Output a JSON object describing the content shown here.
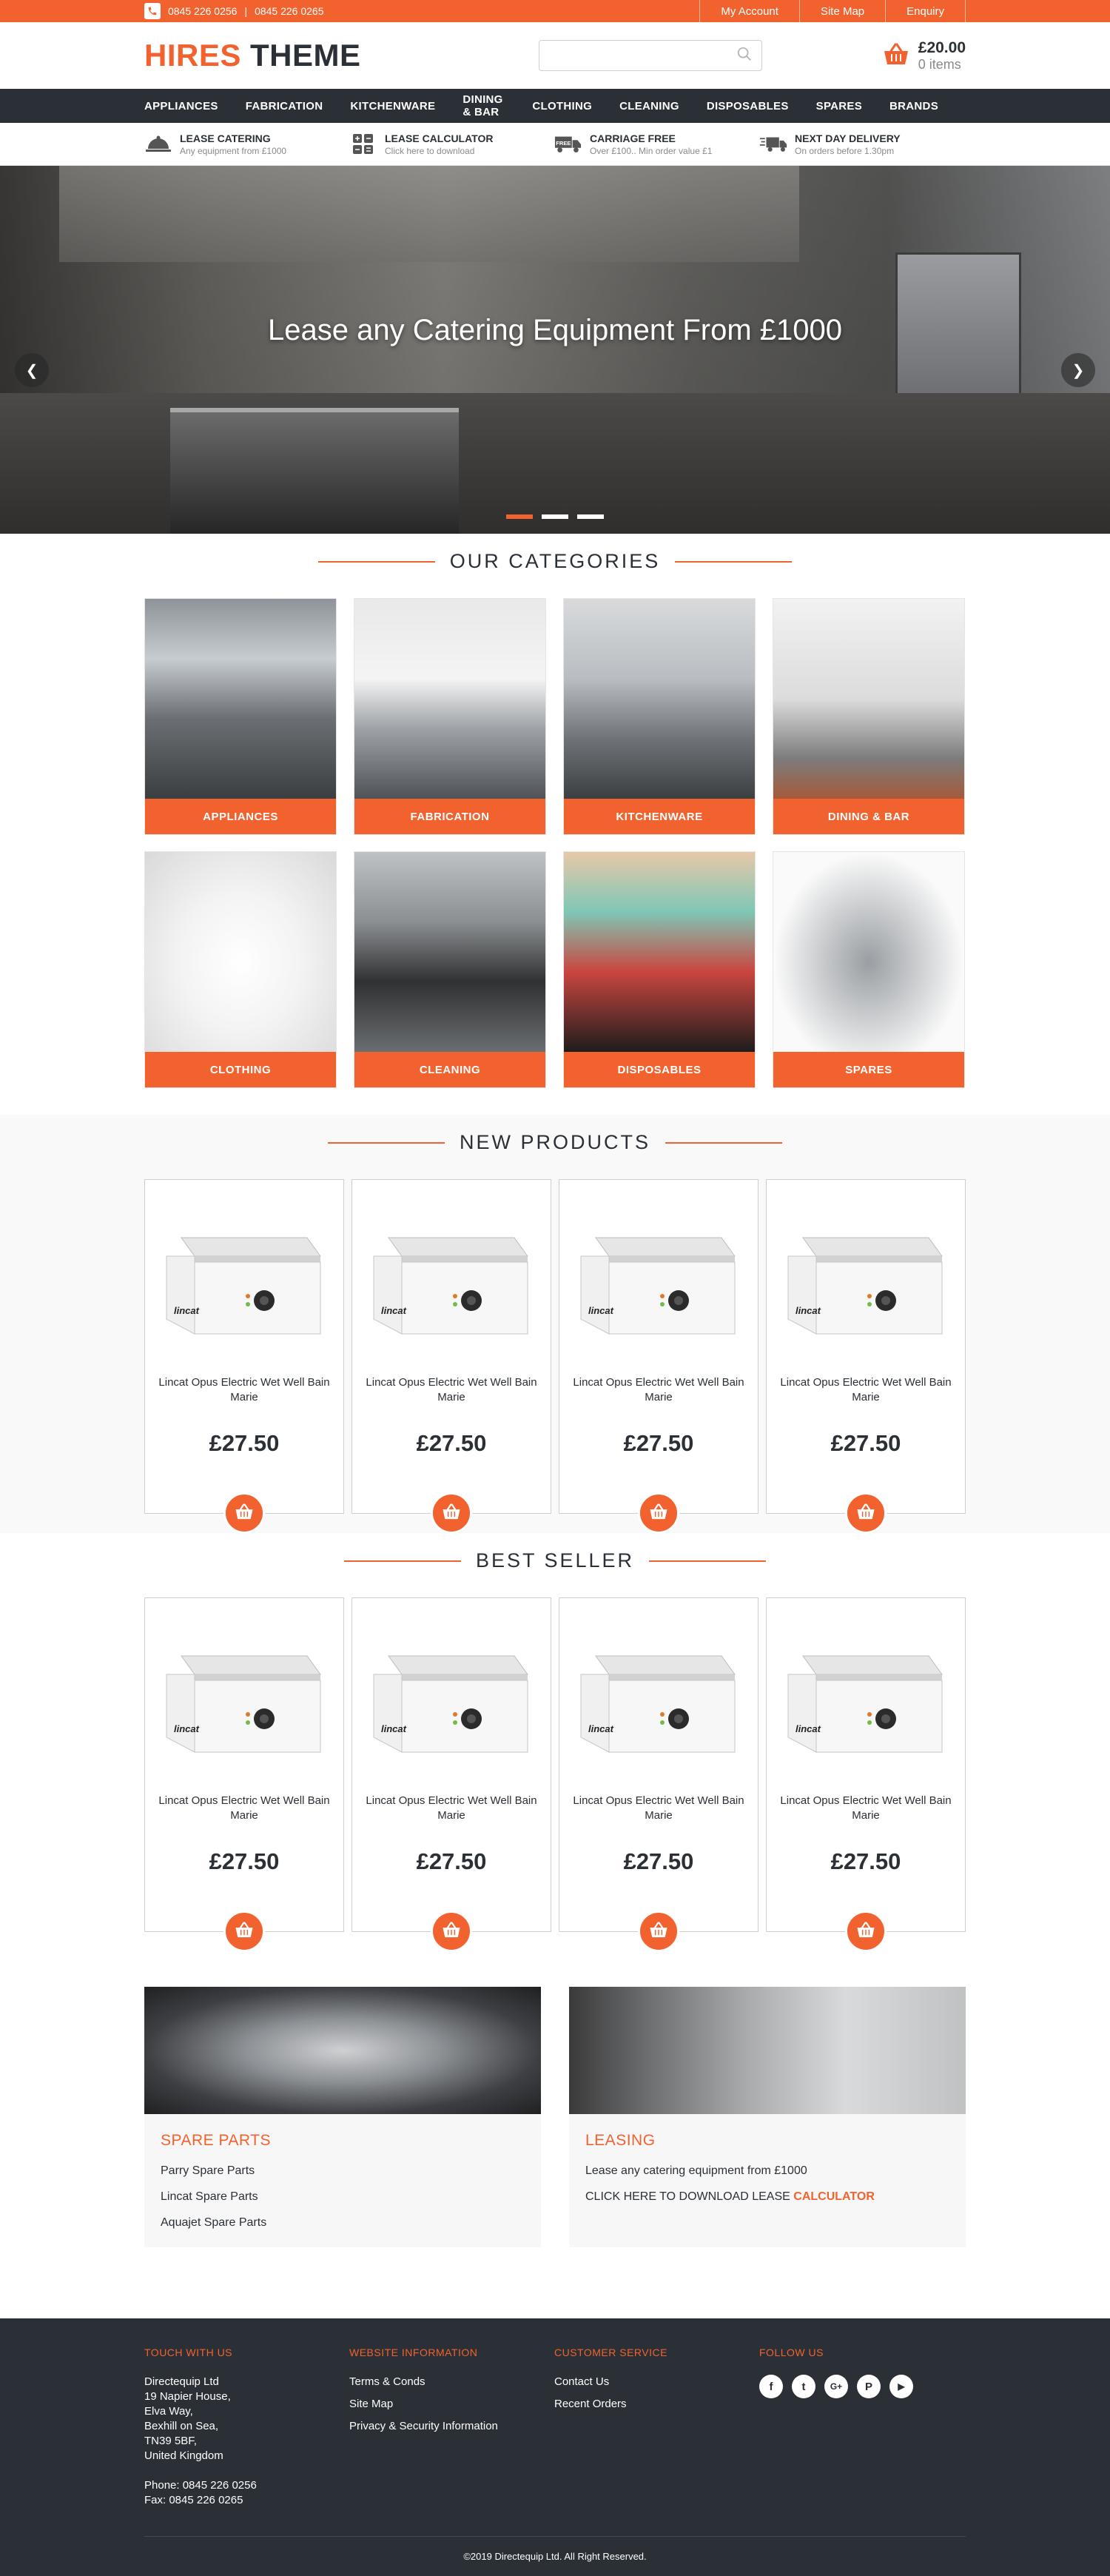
{
  "topbar": {
    "phone_1": "0845 226 0256",
    "phone_2": "0845 226 0265",
    "links": [
      "My Account",
      "Site Map",
      "Enquiry"
    ]
  },
  "header": {
    "logo_part1": "HIRES",
    "logo_part2": "THEME",
    "search_placeholder": "",
    "cart_total": "£20.00",
    "cart_items": "0 items"
  },
  "nav": [
    "APPLIANCES",
    "FABRICATION",
    "KITCHENWARE",
    "DINING & BAR",
    "CLOTHING",
    "CLEANING",
    "DISPOSABLES",
    "SPARES",
    "BRANDS"
  ],
  "usp": [
    {
      "title": "LEASE CATERING",
      "subtitle": "Any equipment from £1000",
      "icon": "cloche-icon"
    },
    {
      "title": "LEASE CALCULATOR",
      "subtitle": "Click here to download",
      "icon": "calculator-icon"
    },
    {
      "title": "CARRIAGE FREE",
      "subtitle": "Over £100.. Min order value £1",
      "icon": "free-truck-icon"
    },
    {
      "title": "NEXT DAY DELIVERY",
      "subtitle": "On orders before 1.30pm",
      "icon": "delivery-truck-icon"
    }
  ],
  "hero": {
    "headline": "Lease any Catering Equipment From £1000",
    "slides": 3,
    "active_slide": 1
  },
  "categories": {
    "title": "OUR CATEGORIES",
    "items": [
      "APPLIANCES",
      "FABRICATION",
      "KITCHENWARE",
      "DINING & BAR",
      "CLOTHING",
      "CLEANING",
      "DISPOSABLES",
      "SPARES"
    ]
  },
  "new_products": {
    "title": "NEW PRODUCTS",
    "items": [
      {
        "name": "Lincat Opus Electric Wet Well Bain Marie",
        "price": "£27.50",
        "brand": "lincat"
      },
      {
        "name": "Lincat Opus Electric Wet Well Bain Marie",
        "price": "£27.50",
        "brand": "lincat"
      },
      {
        "name": "Lincat Opus Electric Wet Well Bain Marie",
        "price": "£27.50",
        "brand": "lincat"
      },
      {
        "name": "Lincat Opus Electric Wet Well Bain Marie",
        "price": "£27.50",
        "brand": "lincat"
      }
    ]
  },
  "best_seller": {
    "title": "BEST SELLER",
    "items": [
      {
        "name": "Lincat Opus Electric Wet Well Bain Marie",
        "price": "£27.50",
        "brand": "lincat"
      },
      {
        "name": "Lincat Opus Electric Wet Well Bain Marie",
        "price": "£27.50",
        "brand": "lincat"
      },
      {
        "name": "Lincat Opus Electric Wet Well Bain Marie",
        "price": "£27.50",
        "brand": "lincat"
      },
      {
        "name": "Lincat Opus Electric Wet Well Bain Marie",
        "price": "£27.50",
        "brand": "lincat"
      }
    ]
  },
  "promos": {
    "spare_parts": {
      "title": "SPARE PARTS",
      "links": [
        "Parry Spare Parts",
        "Lincat Spare Parts",
        "Aquajet Spare Parts"
      ]
    },
    "leasing": {
      "title": "LEASING",
      "line1": "Lease any catering equipment from £1000",
      "line2_prefix": "CLICK HERE TO DOWNLOAD LEASE",
      "line2_link": "CALCULATOR"
    }
  },
  "footer": {
    "touch": {
      "title": "TOUCH WITH US",
      "address": [
        "Directequip Ltd",
        "19 Napier House,",
        "Elva Way,",
        "Bexhill on Sea,",
        "TN39 5BF,",
        "United Kingdom"
      ],
      "phone": "Phone: 0845 226 0256",
      "fax": "Fax: 0845 226 0265"
    },
    "website": {
      "title": "WEBSITE INFORMATION",
      "links": [
        "Terms & Conds",
        "Site Map",
        "Privacy & Security Information"
      ]
    },
    "customer": {
      "title": "CUSTOMER SERVICE",
      "links": [
        "Contact Us",
        "Recent Orders"
      ]
    },
    "follow": {
      "title": "FOLLOW US",
      "socials": [
        {
          "glyph": "f",
          "icon": "facebook-icon"
        },
        {
          "glyph": "t",
          "icon": "twitter-icon"
        },
        {
          "glyph": "G+",
          "icon": "google-plus-icon"
        },
        {
          "glyph": "P",
          "icon": "pinterest-icon"
        },
        {
          "glyph": "▶",
          "icon": "youtube-icon"
        }
      ]
    },
    "copyright": "©2019  Directequip Ltd. All Right Reserved."
  },
  "colors": {
    "accent": "#f2622e",
    "dark": "#2b2f36",
    "light_bg": "#f9f9f9"
  }
}
